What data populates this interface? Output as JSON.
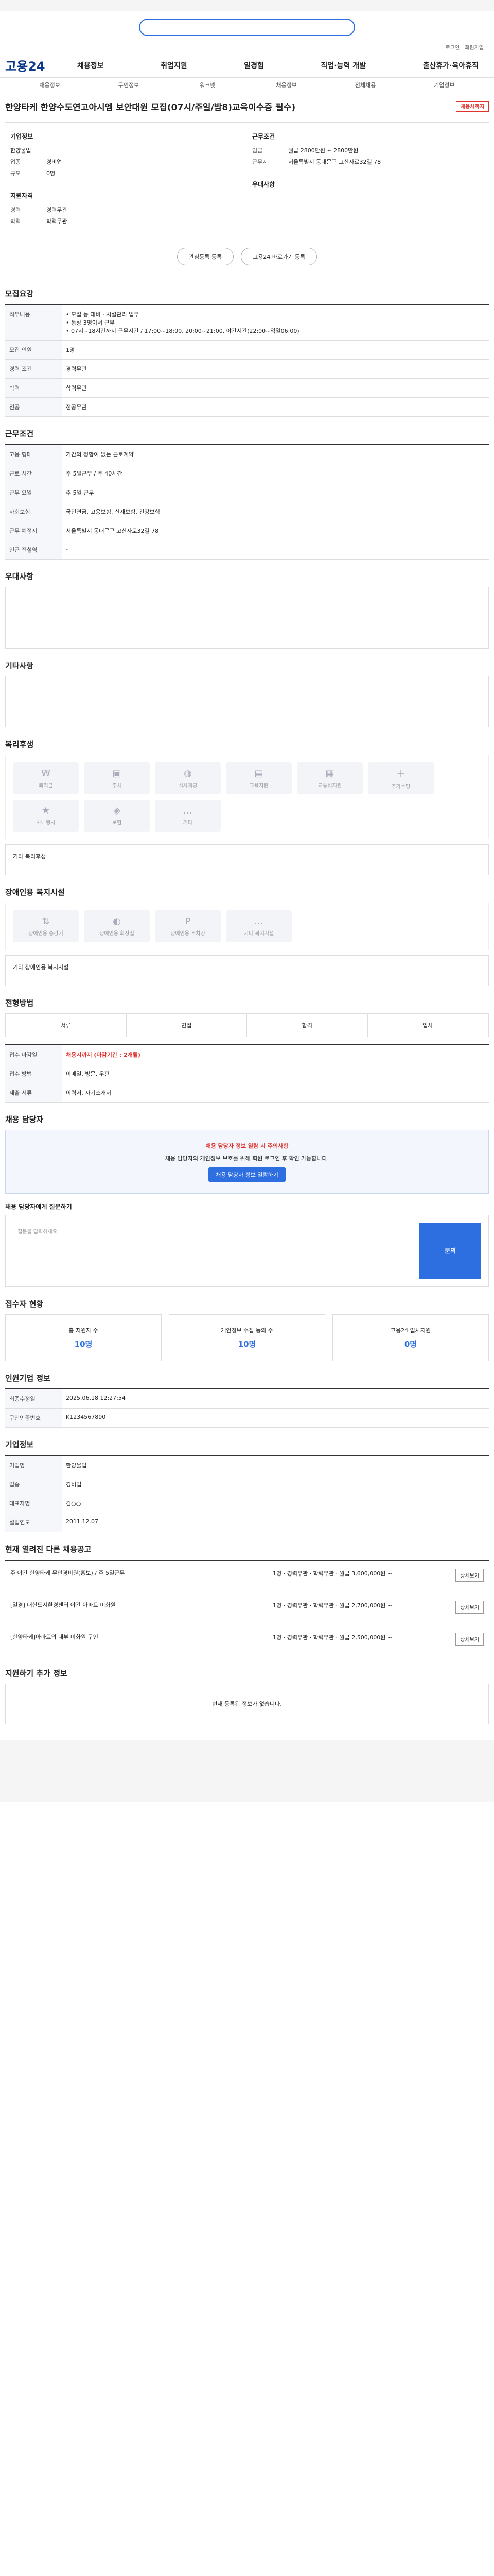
{
  "header": {
    "logo": "고용24",
    "nav": [
      "채용정보",
      "취업지원",
      "일경험",
      "직업·능력 개발",
      "출산휴가·육아휴직"
    ],
    "subnav": [
      "채용정보",
      "구인정보",
      "워크넷",
      "채용정보",
      "전체채용",
      "기업정보"
    ],
    "util": [
      "로그인",
      "회원가입"
    ]
  },
  "job": {
    "title": "한양타케 한양수도연고아시엠 보안대원 모집(07시/주일/밤8)교육이수증 필수)",
    "badge": "채용시까지",
    "company_label": "기업정보",
    "company_name": "한양물업",
    "kv1": [
      [
        "업종",
        "경비업"
      ],
      [
        "규모",
        "0명"
      ]
    ],
    "work_label": "근무조건",
    "kv2": [
      [
        "임금",
        "월급 2800만원 ~ 2800만원"
      ],
      [
        "근무지",
        "서울특별시 동대문구 고산자로32길 78"
      ]
    ],
    "apply_label": "지원자격",
    "kv3": [
      [
        "경력",
        "경력무관"
      ],
      [
        "학력",
        "학력무관"
      ]
    ],
    "prefer_label": "우대사항",
    "save_btn": "관심등록 등록",
    "share_btn": "고용24 바로가기 등록"
  },
  "sections": {
    "recruit": "모집요강",
    "work": "근무조건",
    "prefer": "우대사항",
    "etc": "기타사항",
    "welfare": "복리후생",
    "disabled": "장애인용 복지시설",
    "method": "전형방법",
    "contact": "채용 담당자",
    "applicants": "접수자 현황",
    "info": "인원기업 정보",
    "company": "기업정보",
    "other": "현재 열려진 다른 채용공고",
    "visit": "지원하기 추가 정보"
  },
  "recruit_table": [
    [
      "직무내용",
      "• 모집 등 대비 · 시설관리 업무\n• 통상 3명이서 근무\n• 07시~18시간까지 근무시간 / 17:00~18:00, 20:00~21:00, 야간시간(22:00~익일06:00)"
    ],
    [
      "모집 인원",
      "1명"
    ],
    [
      "경력 조건",
      "경력무관"
    ],
    [
      "학력",
      "학력무관"
    ],
    [
      "전공",
      "전공무관"
    ]
  ],
  "work_table": [
    [
      "고용 형태",
      "기간의 정함이 없는 근로계약"
    ],
    [
      "근로 시간",
      "주 5일근무 / 주 40시간"
    ],
    [
      "근무 요일",
      "주 5일 근무"
    ],
    [
      "사회보험",
      "국민연금, 고용보험, 산재보험, 건강보험"
    ],
    [
      "근무 예정지",
      "서울특별시 동대문구 고산자로32길 78"
    ],
    [
      "인근 전철역",
      "-"
    ]
  ],
  "welfare_icons": [
    "퇴직금",
    "주차",
    "식사제공",
    "교육지원",
    "교통비지원",
    "추가수당",
    "사내행사",
    "보험",
    "기타"
  ],
  "welfare_note": "기타 복리후생",
  "disabled_icons": [
    "장애인용 승강기",
    "장애인용 화장실",
    "장애인용 주차장",
    "기타 복지시설"
  ],
  "disabled_note": "기타 장애인용 복지시설",
  "method_table": [
    [
      "접수 마감일",
      "채용시까지 (마감기간 : 2개월)"
    ],
    [
      "접수 방법",
      "이메일, 방문, 우편"
    ],
    [
      "제출 서류",
      "이력서, 자기소개서"
    ]
  ],
  "method_steps": [
    "서류",
    "면접",
    "합격",
    "입사"
  ],
  "contact": {
    "notice": "채용 담당자 정보 열람 시 주의사항",
    "text": "채용 담당자의 개인정보 보호를 위해 회원 로그인 후 확인 가능합니다.",
    "button": "채용 담당자 정보 열람하기",
    "question_label": "채용 담당자에게 질문하기",
    "question_placeholder": "질문을 입력하세요.",
    "submit": "문의"
  },
  "applicants": [
    {
      "label": "총 지원자 수",
      "value": "10명"
    },
    {
      "label": "개인정보 수집 동의 수",
      "value": "10명"
    },
    {
      "label": "고용24 입사지원",
      "value": "0명"
    }
  ],
  "info_table": [
    [
      "최종수정일",
      "2025.06.18 12:27:54"
    ],
    [
      "구인인증번호",
      "K1234567890"
    ]
  ],
  "company_table": [
    [
      "기업명",
      "한양물업"
    ],
    [
      "업종",
      "경비업"
    ],
    [
      "대표자명",
      "김○○"
    ],
    [
      "설립연도",
      "2011.12.07"
    ]
  ],
  "other_jobs": [
    {
      "title": "주·야간 한양타케 무인경비원(홍보) / 주 5일근무",
      "cond": "1명 · 경력무관 · 학력무관 · 월급 3,600,000원 ~",
      "btn": "상세보기"
    },
    {
      "title": "[일경] 대한도시환경센터 야간 아파트 미화원",
      "cond": "1명 · 경력무관 · 학력무관 · 월급 2,700,000원 ~",
      "btn": "상세보기"
    },
    {
      "title": "[한양타케]아파트의 내부 미화원 구인",
      "cond": "1명 · 경력무관 · 학력무관 · 월급 2,500,000원 ~",
      "btn": "상세보기"
    }
  ],
  "visit_text": "현재 등록된 정보가 없습니다."
}
